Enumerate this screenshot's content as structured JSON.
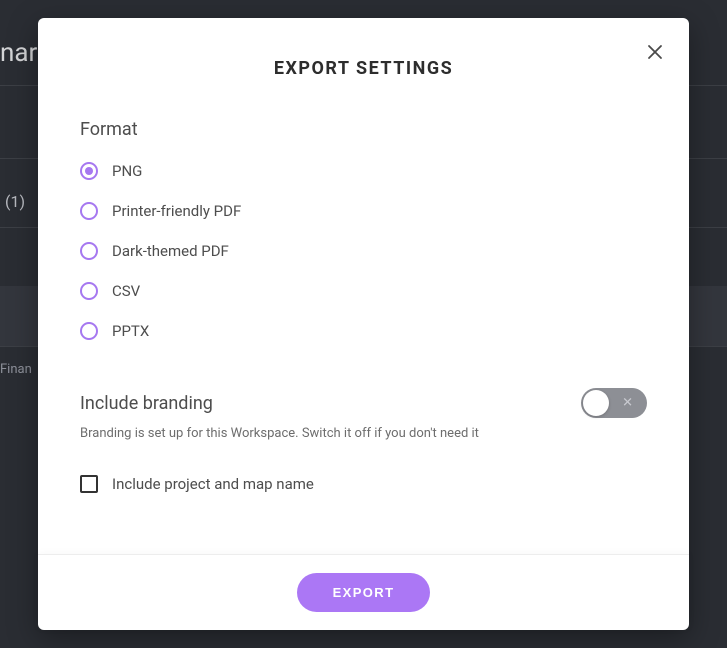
{
  "background": {
    "text1": "nar",
    "text2": "(1)",
    "text3": "Finan"
  },
  "modal": {
    "title": "EXPORT SETTINGS",
    "formatSection": {
      "title": "Format",
      "options": [
        {
          "label": "PNG",
          "selected": true
        },
        {
          "label": "Printer-friendly PDF",
          "selected": false
        },
        {
          "label": "Dark-themed PDF",
          "selected": false
        },
        {
          "label": "CSV",
          "selected": false
        },
        {
          "label": "PPTX",
          "selected": false
        }
      ]
    },
    "branding": {
      "title": "Include branding",
      "description": "Branding is set up for this Workspace. Switch it off if you don't need it",
      "enabled": false
    },
    "includeProjectMap": {
      "label": "Include project and map name",
      "checked": false
    },
    "exportButton": "EXPORT"
  }
}
